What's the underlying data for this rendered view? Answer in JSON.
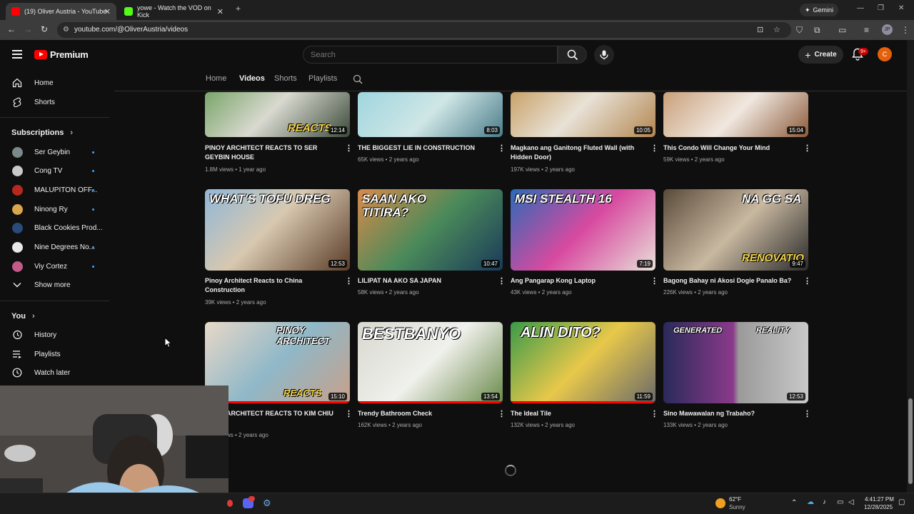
{
  "browser": {
    "tabs": [
      {
        "title": "(19) Oliver Austria - YouTube",
        "active": true
      },
      {
        "title": "yowe - Watch the VOD on Kick",
        "active": false
      }
    ],
    "new_tab_icon": "plus-icon",
    "gemini_label": "Gemini",
    "url": "youtube.com/@OliverAustria/videos",
    "profile_initials": "JP"
  },
  "youtube": {
    "logo_text": "Premium",
    "search_placeholder": "Search",
    "create_label": "Create",
    "notif_badge": "9+",
    "avatar_letter": "C"
  },
  "sidebar": {
    "main": [
      {
        "label": "Home",
        "icon": "home-icon"
      },
      {
        "label": "Shorts",
        "icon": "shorts-icon"
      }
    ],
    "subscriptions_title": "Subscriptions",
    "subscriptions": [
      {
        "label": "Ser Geybin",
        "color": "#7a8a8a"
      },
      {
        "label": "Cong TV",
        "color": "#c9c9c9"
      },
      {
        "label": "MALUPITON OFF...",
        "color": "#b8281e"
      },
      {
        "label": "Ninong Ry",
        "color": "#d9a64a"
      },
      {
        "label": "Black Cookies Prod...",
        "color": "#2a4a7a"
      },
      {
        "label": "Nine Degrees No...",
        "color": "#e8e8e8"
      },
      {
        "label": "Viy Cortez",
        "color": "#c45a8a"
      }
    ],
    "show_more": "Show more",
    "you_title": "You",
    "you_items": [
      {
        "label": "History",
        "icon": "history-icon"
      },
      {
        "label": "Playlists",
        "icon": "playlists-icon"
      },
      {
        "label": "Watch later",
        "icon": "watch-later-icon"
      }
    ]
  },
  "channel_tabs": [
    "Home",
    "Videos",
    "Shorts",
    "Playlists"
  ],
  "videos": [
    {
      "title": "PINOY ARCHITECT REACTS TO SER GEYBIN HOUSE",
      "meta": "1.8M views • 1 year ago",
      "duration": "12:14",
      "thumb_text": "REACTS"
    },
    {
      "title": "THE BIGGEST LIE IN CONSTRUCTION",
      "meta": "65K views • 2 years ago",
      "duration": "8:03",
      "thumb_text": ""
    },
    {
      "title": "Magkano ang Ganitong Fluted Wall (with Hidden Door)",
      "meta": "197K views • 2 years ago",
      "duration": "10:05",
      "thumb_text": ""
    },
    {
      "title": "This Condo Will Change Your Mind",
      "meta": "59K views • 2 years ago",
      "duration": "15:04",
      "thumb_text": ""
    },
    {
      "title": "Pinoy Architect Reacts to China Construction",
      "meta": "39K views • 2 years ago",
      "duration": "12:53",
      "thumb_text": "WHAT'S TOFU DREG"
    },
    {
      "title": "LILIPAT NA AKO SA JAPAN",
      "meta": "58K views • 2 years ago",
      "duration": "10:47",
      "thumb_text": "SAAN AKO TITIRA?"
    },
    {
      "title": "Ang Pangarap Kong Laptop",
      "meta": "43K views • 2 years ago",
      "duration": "7:19",
      "thumb_text": "MSI STEALTH 16"
    },
    {
      "title": "Bagong Bahay ni Akosi Dogie Panalo Ba?",
      "meta": "226K views • 2 years ago",
      "duration": "9:47",
      "thumb_text": "NA GG SA"
    },
    {
      "title": "ARCHITECT REACTS TO KIM CHIU",
      "meta": "ws • 2 years ago",
      "duration": "15:10",
      "thumb_text": "PINOY ARCHITECT"
    },
    {
      "title": "Trendy Bathroom Check",
      "meta": "162K views • 2 years ago",
      "duration": "13:54",
      "thumb_text": "BESTBANYO"
    },
    {
      "title": "The Ideal Tile",
      "meta": "132K views • 2 years ago",
      "duration": "11:59",
      "thumb_text": "ALIN DITO?"
    },
    {
      "title": "Sino Mawawalan ng Trabaho?",
      "meta": "133K views • 2 years ago",
      "duration": "12:53",
      "thumb_text": "GENERATED"
    }
  ],
  "thumb_extra": {
    "renovation": "RENOVATIO",
    "reacts2": "REACTS",
    "reality": "REALITY"
  },
  "taskbar": {
    "weather_temp": "62°F",
    "weather_desc": "Sunny",
    "time": "4:41:27 PM",
    "date": "12/28/2025"
  }
}
